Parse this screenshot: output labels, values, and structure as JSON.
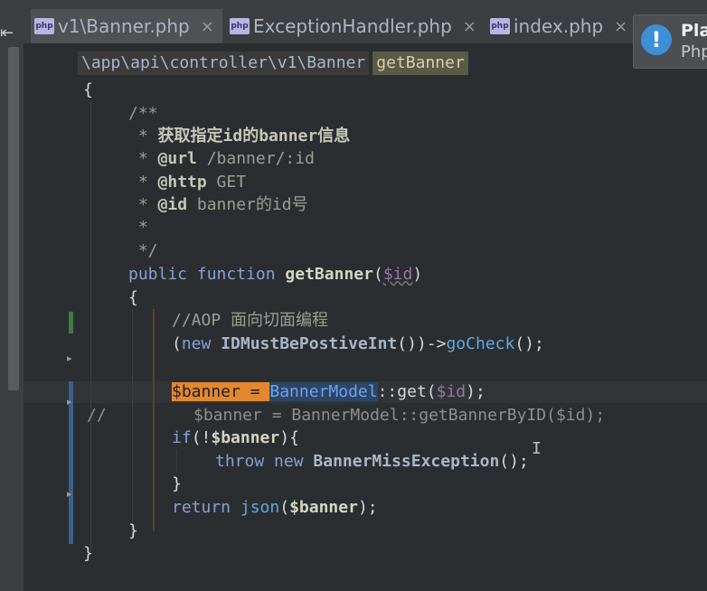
{
  "tabs": [
    {
      "label": "v1\\Banner.php",
      "icon": "php-file-icon",
      "active": true
    },
    {
      "label": "ExceptionHandler.php",
      "icon": "php-file-icon",
      "active": false
    },
    {
      "label": "index.php",
      "icon": "php-file-icon",
      "active": false
    }
  ],
  "tab_icon_text": "php",
  "tab_close_glyph": "×",
  "notification": {
    "title": "Pla",
    "subtitle": "Php",
    "icon": "info-icon",
    "icon_glyph": "!"
  },
  "breadcrumb": {
    "path": "\\app\\api\\controller\\v1\\Banner",
    "method": "getBanner"
  },
  "code": {
    "l1": "{",
    "l2": "/**",
    "l3_star": " * ",
    "l3_text": "获取指定id的banner信息",
    "l4_star": " * ",
    "l4_tag": "@url",
    "l4_text": " /banner/:id",
    "l5_star": " * ",
    "l5_tag": "@http",
    "l5_text": " GET",
    "l6_star": " * ",
    "l6_tag": "@id",
    "l6_text": " banner的id号",
    "l7": " *",
    "l8": " */",
    "l9_kw1": "public",
    "l9_kw2": "function",
    "l9_fn": "getBanner",
    "l9_open": "(",
    "l9_var": "$id",
    "l9_close": ")",
    "l10": "{",
    "l11": "//AOP 面向切面编程",
    "l12_open": "(",
    "l12_kw": "new",
    "l12_cls": "IDMustBePostiveInt",
    "l12_mid": "())->",
    "l12_method": "goCheck",
    "l12_end": "();",
    "l13_var": "$banner",
    "l13_eq": " = ",
    "l13_cls": "BannerModel",
    "l13_rest_a": "::get(",
    "l13_var2": "$id",
    "l13_rest_b": ");",
    "l14_slash": "//",
    "l14_code": "$banner = BannerModel::getBannerByID($id);",
    "l15_kw": "if",
    "l15_open": "(!",
    "l15_var": "$banner",
    "l15_close": "){",
    "l16_kw1": "throw",
    "l16_kw2": "new",
    "l16_cls": "BannerMissException",
    "l16_end": "();",
    "l17": "}",
    "l18_kw": "return",
    "l18_fn": "json",
    "l18_open": "(",
    "l18_var": "$banner",
    "l18_end": ");",
    "l19": "}",
    "l20": "}"
  },
  "mouse_cursor": "I",
  "colors": {
    "background": "#2b2e31",
    "keyword": "#cc7832",
    "variable": "#9876aa",
    "method": "#5fa8e0",
    "highlight_var": "#e3872f",
    "highlight_class": "#2e4566",
    "gutter_change": "#3f7a3f",
    "gutter_modified": "#3f5f8a"
  }
}
